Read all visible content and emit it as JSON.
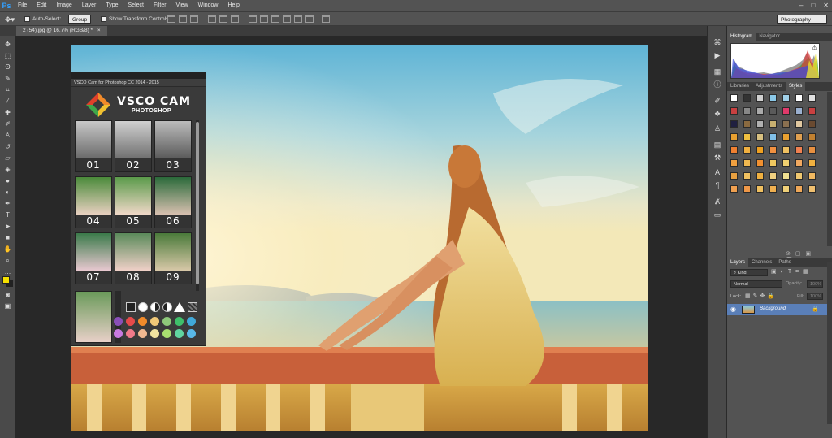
{
  "menu": {
    "logo": "Ps",
    "items": [
      "File",
      "Edit",
      "Image",
      "Layer",
      "Type",
      "Select",
      "Filter",
      "View",
      "Window",
      "Help"
    ],
    "window_controls": [
      "–",
      "□",
      "✕"
    ]
  },
  "options": {
    "auto_select_label": "Auto-Select:",
    "auto_select_value": "Group",
    "transform_label": "Show Transform Controls",
    "workspace": "Photography"
  },
  "document": {
    "tab_label": "2 (54).jpg @ 16.7% (RGB/8) *",
    "close": "×"
  },
  "vsco": {
    "panel_title": "VSCO Cam for Photoshop CC 2014 - 2015",
    "brand_name": "VSCO CAM",
    "brand_sub": "PHOTOSHOP",
    "presets": [
      "01",
      "02",
      "03",
      "04",
      "05",
      "06",
      "07",
      "08",
      "09"
    ],
    "swatches": [
      "#8a4fb8",
      "#e64a4a",
      "#f08a2a",
      "#f0c878",
      "#8ec97a",
      "#3fbf6a",
      "#40a8d8",
      "#c87ae0",
      "#f07a8a",
      "#f0b890",
      "#f0e4a0",
      "#a8e070",
      "#60d4a0",
      "#58b8e8"
    ]
  },
  "right_panel": {
    "top_tabs": [
      "Histogram",
      "Navigator"
    ],
    "mid_tabs": [
      "Libraries",
      "Adjustments",
      "Styles"
    ],
    "layer_tabs": [
      "Layers",
      "Channels",
      "Paths"
    ],
    "kind_label": "Kind",
    "blend_mode": "Normal",
    "opacity_label": "Opacity:",
    "opacity_value": "100%",
    "lock_label": "Lock:",
    "fill_label": "Fill:",
    "fill_value": "100%",
    "layer_name": "Background"
  },
  "colors": {
    "foreground": "#f5e000",
    "background": "#222222",
    "accent_blue": "#5a7fb8"
  }
}
